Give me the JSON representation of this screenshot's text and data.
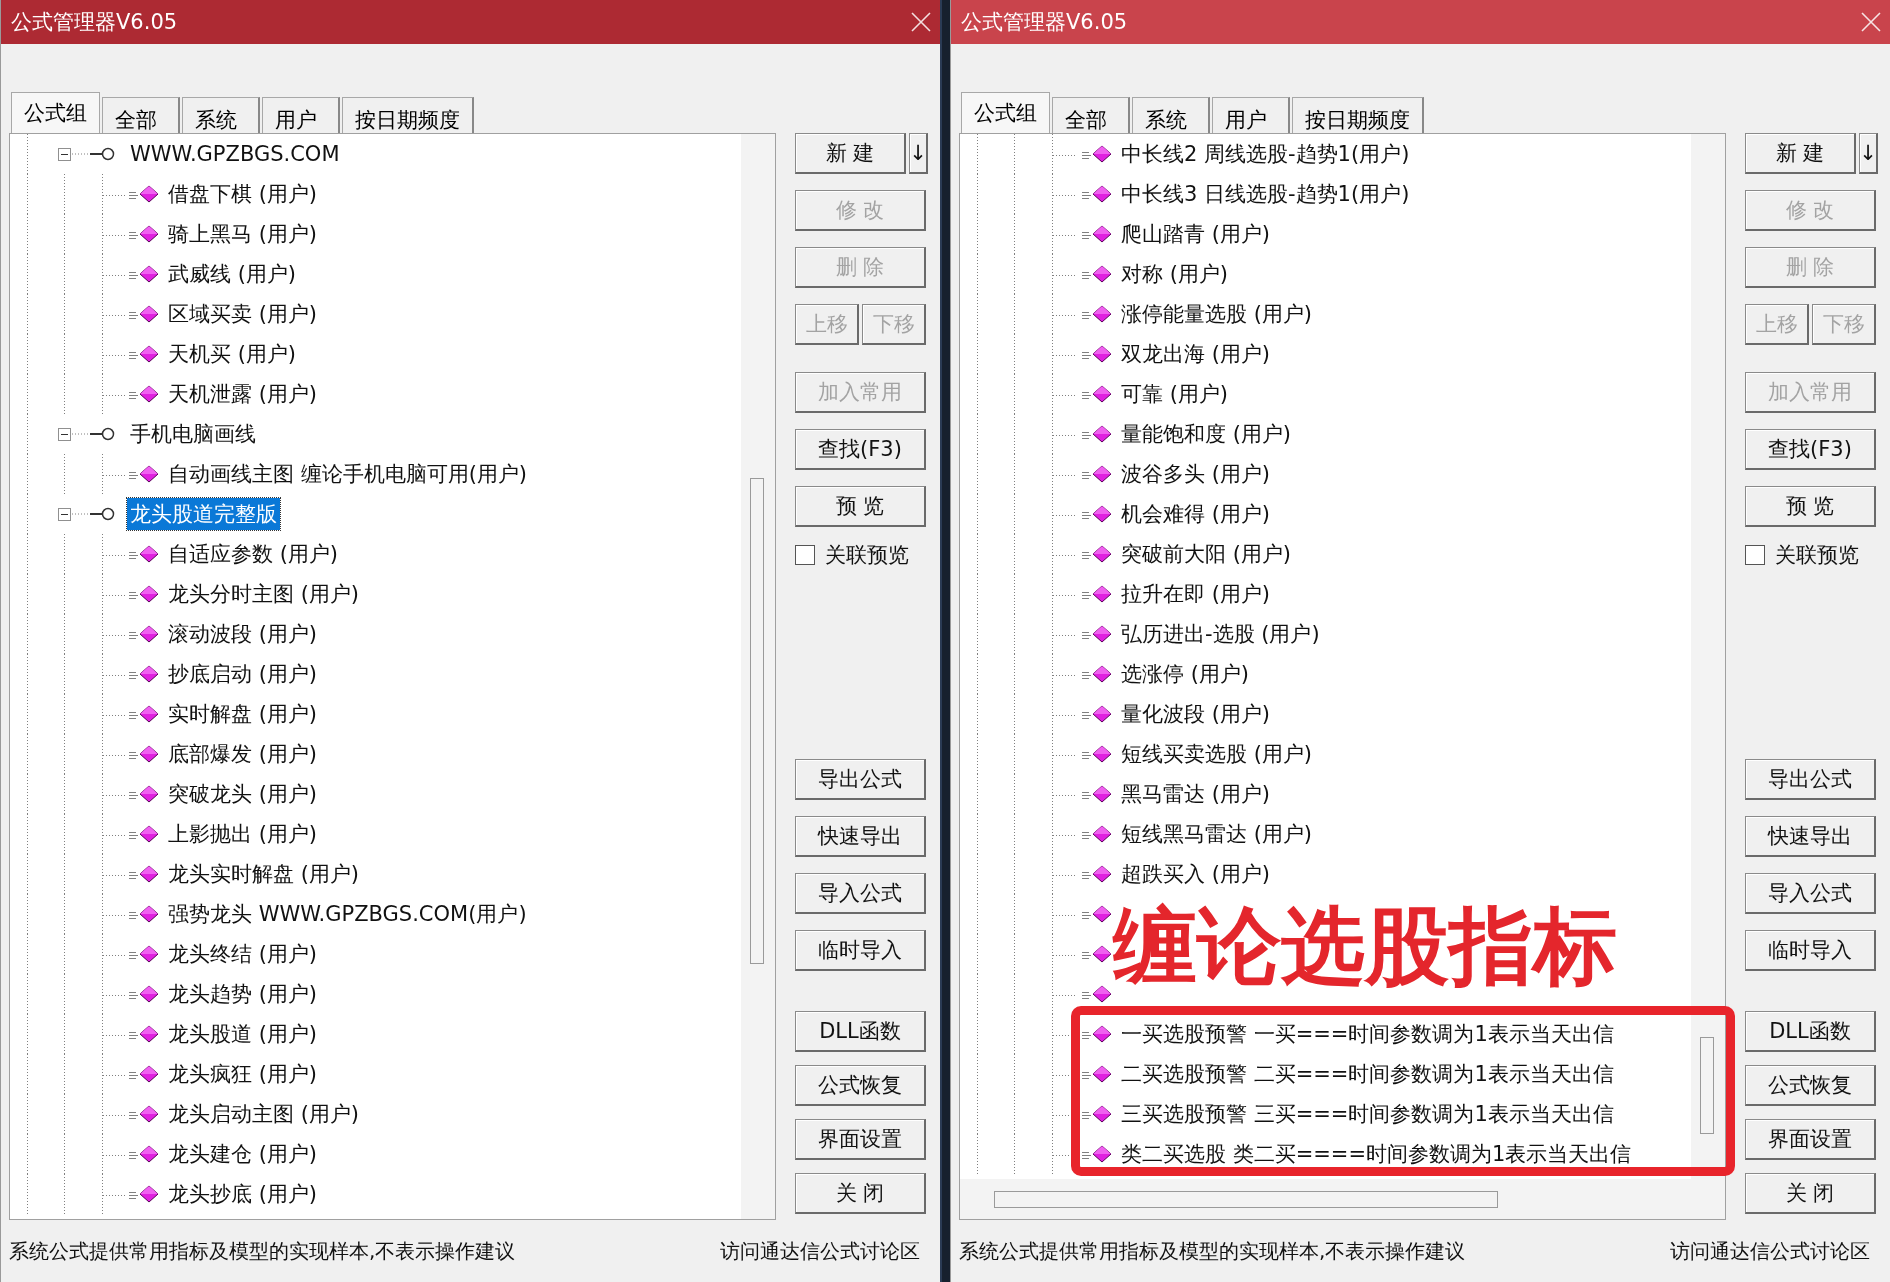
{
  "windows": [
    {
      "title": "公式管理器V6.05",
      "active": true,
      "tabs": [
        {
          "label": "公式组",
          "selected": true
        },
        {
          "label": "全部",
          "selected": false
        },
        {
          "label": "系统",
          "selected": false
        },
        {
          "label": "用户",
          "selected": false
        },
        {
          "label": "按日期频度",
          "selected": false
        }
      ],
      "tree": [
        {
          "label": "WWW.GPZBGS.COM",
          "expanded": true,
          "selected": false,
          "children": [
            {
              "label": "借盘下棋  (用户)"
            },
            {
              "label": "骑上黑马  (用户)"
            },
            {
              "label": "武威线  (用户)"
            },
            {
              "label": "区域买卖  (用户)"
            },
            {
              "label": "天机买  (用户)"
            },
            {
              "label": "天机泄露  (用户)"
            }
          ]
        },
        {
          "label": "手机电脑画线",
          "expanded": true,
          "selected": false,
          "children": [
            {
              "label": "自动画线主图  缠论手机电脑可用(用户)"
            }
          ]
        },
        {
          "label": "龙头股道完整版",
          "expanded": true,
          "selected": true,
          "children": [
            {
              "label": "自适应参数  (用户)"
            },
            {
              "label": "龙头分时主图  (用户)"
            },
            {
              "label": "滚动波段  (用户)"
            },
            {
              "label": "抄底启动  (用户)"
            },
            {
              "label": "实时解盘  (用户)"
            },
            {
              "label": "底部爆发  (用户)"
            },
            {
              "label": "突破龙头  (用户)"
            },
            {
              "label": "上影抛出  (用户)"
            },
            {
              "label": "龙头实时解盘  (用户)"
            },
            {
              "label": "强势龙头  WWW.GPZBGS.COM(用户)"
            },
            {
              "label": "龙头终结  (用户)"
            },
            {
              "label": "龙头趋势  (用户)"
            },
            {
              "label": "龙头股道  (用户)"
            },
            {
              "label": "龙头疯狂  (用户)"
            },
            {
              "label": "龙头启动主图  (用户)"
            },
            {
              "label": "龙头建仓  (用户)"
            },
            {
              "label": "龙头抄底  (用户)"
            }
          ]
        }
      ],
      "button_sections": [
        [
          [
            {
              "label": "新 建",
              "disabled": false,
              "kind": "main"
            },
            {
              "label": "↓",
              "disabled": false,
              "kind": "arrow"
            }
          ],
          [
            {
              "label": "修 改",
              "disabled": true,
              "kind": "main"
            }
          ],
          [
            {
              "label": "删 除",
              "disabled": true,
              "kind": "main"
            }
          ],
          [
            {
              "label": "上移",
              "disabled": true,
              "kind": "half"
            },
            {
              "label": "下移",
              "disabled": true,
              "kind": "half"
            }
          ],
          [
            {
              "label": "加入常用",
              "disabled": true,
              "kind": "main"
            }
          ],
          [
            {
              "label": "查找(F3)",
              "disabled": false,
              "kind": "main"
            }
          ],
          [
            {
              "label": "预 览",
              "disabled": false,
              "kind": "main"
            }
          ]
        ],
        [
          [
            {
              "label": "导出公式",
              "disabled": false,
              "kind": "main"
            }
          ],
          [
            {
              "label": "快速导出",
              "disabled": false,
              "kind": "main"
            }
          ],
          [
            {
              "label": "导入公式",
              "disabled": false,
              "kind": "main"
            }
          ],
          [
            {
              "label": "临时导入",
              "disabled": false,
              "kind": "main"
            }
          ]
        ],
        [
          [
            {
              "label": "DLL函数",
              "disabled": false,
              "kind": "main"
            }
          ],
          [
            {
              "label": "公式恢复",
              "disabled": false,
              "kind": "main"
            }
          ],
          [
            {
              "label": "界面设置",
              "disabled": false,
              "kind": "main"
            }
          ],
          [
            {
              "label": "关 闭",
              "disabled": false,
              "kind": "main"
            }
          ]
        ]
      ],
      "checkbox": {
        "label": "关联预览",
        "checked": false
      },
      "status_bar": {
        "left": "系统公式提供常用指标及模型的实现样本,不表示操作建议",
        "right": "访问通达信公式讨论区"
      }
    },
    {
      "title": "公式管理器V6.05",
      "active": false,
      "tabs": [
        {
          "label": "公式组",
          "selected": true
        },
        {
          "label": "全部",
          "selected": false
        },
        {
          "label": "系统",
          "selected": false
        },
        {
          "label": "用户",
          "selected": false
        },
        {
          "label": "按日期频度",
          "selected": false
        }
      ],
      "tree": [
        {
          "children": [
            {
              "kind": "labeled",
              "label": "中长线2  周线选股-趋势1(用户)"
            },
            {
              "kind": "labeled",
              "label": "中长线3  日线选股-趋势1(用户)"
            },
            {
              "kind": "labeled",
              "label": "爬山踏青  (用户)"
            },
            {
              "kind": "labeled",
              "label": "对称  (用户)"
            },
            {
              "kind": "labeled",
              "label": "涨停能量选股  (用户)"
            },
            {
              "kind": "labeled",
              "label": "双龙出海  (用户)"
            },
            {
              "kind": "labeled",
              "label": "可靠  (用户)"
            },
            {
              "kind": "labeled",
              "label": "量能饱和度  (用户)"
            },
            {
              "kind": "labeled",
              "label": "波谷多头  (用户)"
            },
            {
              "kind": "labeled",
              "label": "机会难得  (用户)"
            },
            {
              "kind": "labeled",
              "label": "突破前大阳  (用户)"
            },
            {
              "kind": "labeled",
              "label": "拉升在即  (用户)"
            },
            {
              "kind": "labeled",
              "label": "弘历进出-选股  (用户)"
            },
            {
              "kind": "labeled",
              "label": "选涨停  (用户)"
            },
            {
              "kind": "labeled",
              "label": "量化波段  (用户)"
            },
            {
              "kind": "labeled",
              "label": "短线买卖选股  (用户)"
            },
            {
              "kind": "labeled",
              "label": "黑马雷达  (用户)"
            },
            {
              "kind": "labeled",
              "label": "短线黑马雷达  (用户)"
            },
            {
              "kind": "labeled",
              "label": "超跌买入  (用户)"
            },
            {
              "kind": "covered"
            },
            {
              "kind": "covered"
            },
            {
              "kind": "covered"
            },
            {
              "kind": "labeled",
              "label": "一买选股预警  一买===时间参数调为1表示当天出信"
            },
            {
              "kind": "labeled",
              "label": "二买选股预警  二买===时间参数调为1表示当天出信"
            },
            {
              "kind": "labeled",
              "label": "三买选股预警  三买===时间参数调为1表示当天出信"
            },
            {
              "kind": "labeled",
              "label": "类二买选股  类二买====时间参数调为1表示当天出信"
            }
          ]
        }
      ],
      "horizontal_scrollbar": true,
      "button_sections": [
        [
          [
            {
              "label": "新 建",
              "disabled": false,
              "kind": "main"
            },
            {
              "label": "↓",
              "disabled": false,
              "kind": "arrow"
            }
          ],
          [
            {
              "label": "修 改",
              "disabled": true,
              "kind": "main"
            }
          ],
          [
            {
              "label": "删 除",
              "disabled": true,
              "kind": "main"
            }
          ],
          [
            {
              "label": "上移",
              "disabled": true,
              "kind": "half"
            },
            {
              "label": "下移",
              "disabled": true,
              "kind": "half"
            }
          ],
          [
            {
              "label": "加入常用",
              "disabled": true,
              "kind": "main"
            }
          ],
          [
            {
              "label": "查找(F3)",
              "disabled": false,
              "kind": "main"
            }
          ],
          [
            {
              "label": "预 览",
              "disabled": false,
              "kind": "main"
            }
          ]
        ],
        [
          [
            {
              "label": "导出公式",
              "disabled": false,
              "kind": "main"
            }
          ],
          [
            {
              "label": "快速导出",
              "disabled": false,
              "kind": "main"
            }
          ],
          [
            {
              "label": "导入公式",
              "disabled": false,
              "kind": "main"
            }
          ],
          [
            {
              "label": "临时导入",
              "disabled": false,
              "kind": "main"
            }
          ]
        ],
        [
          [
            {
              "label": "DLL函数",
              "disabled": false,
              "kind": "main"
            }
          ],
          [
            {
              "label": "公式恢复",
              "disabled": false,
              "kind": "main"
            }
          ],
          [
            {
              "label": "界面设置",
              "disabled": false,
              "kind": "main"
            }
          ],
          [
            {
              "label": "关 闭",
              "disabled": false,
              "kind": "main"
            }
          ]
        ]
      ],
      "checkbox": {
        "label": "关联预览",
        "checked": false
      },
      "status_bar": {
        "left": "系统公式提供常用指标及模型的实现样本,不表示操作建议",
        "right": "访问通达信公式讨论区"
      },
      "annotation": {
        "text": "缠论选股指标"
      }
    }
  ]
}
